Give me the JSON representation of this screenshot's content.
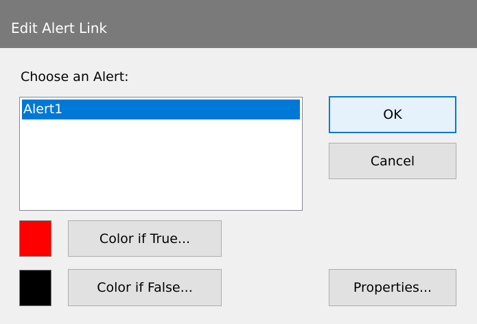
{
  "window": {
    "title": "Edit Alert Link"
  },
  "alert_list": {
    "label": "Choose an Alert:",
    "items": [
      "Alert1"
    ],
    "selected_index": 0
  },
  "buttons": {
    "ok_label": "OK",
    "cancel_label": "Cancel",
    "color_true_label": "Color if True...",
    "color_false_label": "Color if False...",
    "properties_label": "Properties..."
  },
  "colors": {
    "true_color": "#ff0000",
    "false_color": "#000000",
    "selection": "#0078d7",
    "titlebar": "#7a7a7a"
  }
}
